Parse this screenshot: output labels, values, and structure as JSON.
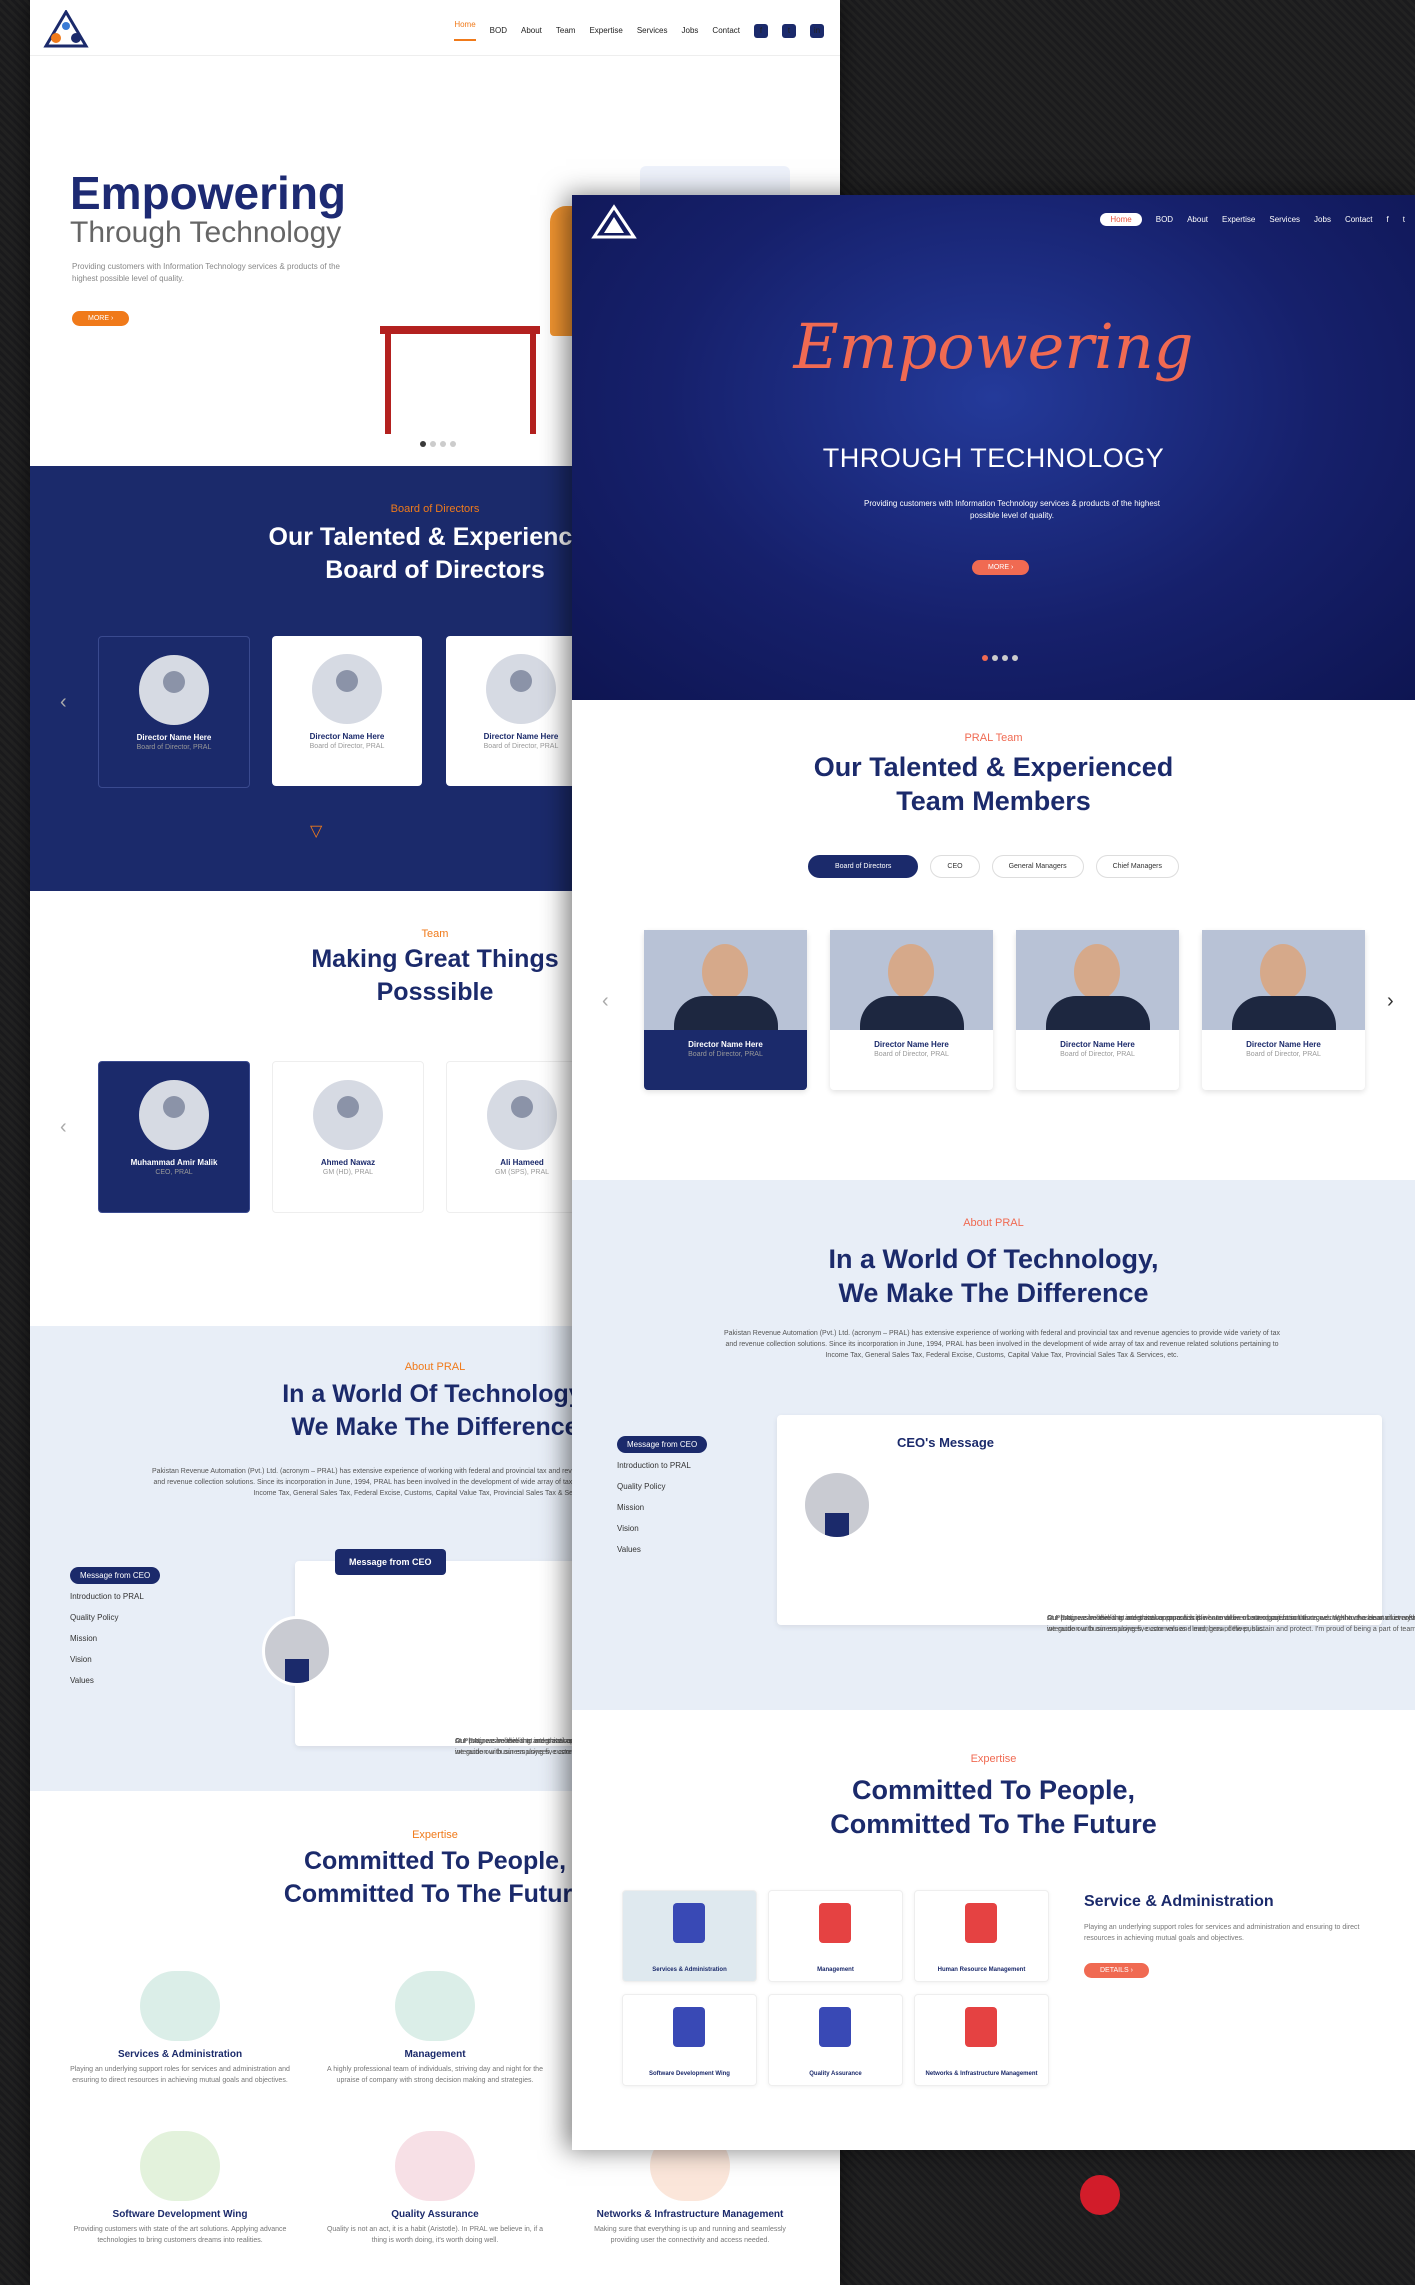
{
  "colors": {
    "navy": "#1b2a6b",
    "orange": "#f07a1a",
    "coral": "#f06a52",
    "light_blue": "#e8eef7"
  },
  "page_a": {
    "nav": [
      "Home",
      "BOD",
      "About",
      "Team",
      "Expertise",
      "Services",
      "Jobs",
      "Contact"
    ],
    "hero": {
      "title": "Empowering",
      "subtitle": "Through Technology",
      "text": "Providing customers with Information Technology services & products of the highest possible level of quality.",
      "button": "MORE ›"
    },
    "bod": {
      "label": "Board of Directors",
      "heading1": "Our Talented & Experienced",
      "heading2": "Board of Directors",
      "cards": [
        {
          "name": "Director Name Here",
          "role": "Board of Director, PRAL"
        },
        {
          "name": "Director Name Here",
          "role": "Board of Director, PRAL"
        },
        {
          "name": "Director Name Here",
          "role": "Board of Director, PRAL"
        }
      ]
    },
    "team": {
      "label": "Team",
      "heading1": "Making Great Things",
      "heading2": "Posssible",
      "cards": [
        {
          "name": "Muhammad Amir Malik",
          "role": "CEO, PRAL"
        },
        {
          "name": "Ahmed Nawaz",
          "role": "GM (HD), PRAL"
        },
        {
          "name": "Ali Hameed",
          "role": "GM (SPS), PRAL"
        }
      ]
    },
    "about": {
      "label": "About PRAL",
      "heading1": "In a World Of Technology,",
      "heading2": "We Make The Difference",
      "text": "Pakistan Revenue Automation (Pvt.) Ltd. (acronym – PRAL) has extensive experience of working with federal and provincial tax and revenue agencies to provide wide variety of tax and revenue collection solutions. Since its incorporation in June, 1994, PRAL has been involved in the development of wide array of tax and revenue related solutions pertaining to Income Tax, General Sales Tax, Federal Excise, Customs, Capital Value Tax, Provincial Sales Tax & Services, etc.",
      "menu": [
        "Message from CEO",
        "Introduction to PRAL",
        "Quality Policy",
        "Mission",
        "Vision",
        "Values"
      ],
      "ceo_tab": "Message from CEO",
      "ceo_text1": "At PRAL, we believe that an ethical approach is the core value of our organization that goes right to the heart of everything we stand for. Ethical values are evident in every interaction with our employees, customers and members of the public.",
      "ceo_text2": "Our business model is to integrate our core disciplines to deliver better project solutions across the chosen market areas.",
      "ceo_text3": "Our progressive thinking and creative approach is what makes us stand out from the crowd. We have a clear vision of what we want to be - leaders in the chosen market areas, and we guide our business using five core values - lead, grow, deliver, sustain and protect. I'm proud of being a part of team and the work we do in PRAL."
    },
    "expertise": {
      "label": "Expertise",
      "heading1": "Committed To People,",
      "heading2": "Committed To The Future",
      "services": [
        {
          "title": "Services & Administration",
          "desc": "Playing an underlying support roles for services and administration and ensuring to direct resources in achieving mutual goals and objectives."
        },
        {
          "title": "Management",
          "desc": "A highly professional team of individuals, striving day and night for the upraise of company with strong decision making and strategies."
        },
        {
          "title": "Software Development Wing",
          "desc": "Providing customers with state of the art solutions. Applying advance technologies to bring customers dreams into realities."
        },
        {
          "title": "Quality Assurance",
          "desc": "Quality is not an act, it is a habit (Aristotle). In PRAL we believe in, if a thing is worth doing, it's worth doing well."
        },
        {
          "title": "Networks & Infrastructure Management",
          "desc": "Making sure that everything is up and running and seamlessly providing user the connectivity and access needed."
        }
      ]
    }
  },
  "page_b": {
    "nav": [
      "Home",
      "BOD",
      "About",
      "Expertise",
      "Services",
      "Jobs",
      "Contact"
    ],
    "hero": {
      "script": "Empowering",
      "title": "THROUGH TECHNOLOGY",
      "text": "Providing customers with Information Technology services & products of the highest possible level of quality.",
      "button": "MORE ›"
    },
    "team": {
      "label": "PRAL Team",
      "heading1": "Our Talented & Experienced",
      "heading2": "Team Members",
      "tabs": [
        "Board of Directors",
        "CEO",
        "General Managers",
        "Chief Managers"
      ],
      "cards": [
        {
          "name": "Director Name Here",
          "role": "Board of Director, PRAL"
        },
        {
          "name": "Director Name Here",
          "role": "Board of Director, PRAL"
        },
        {
          "name": "Director Name Here",
          "role": "Board of Director, PRAL"
        },
        {
          "name": "Director Name Here",
          "role": "Board of Director, PRAL"
        }
      ]
    },
    "about": {
      "label": "About PRAL",
      "heading1": "In a World Of Technology,",
      "heading2": "We Make The Difference",
      "text": "Pakistan Revenue Automation (Pvt.) Ltd. (acronym – PRAL) has extensive experience of working with federal and provincial tax and revenue agencies to provide wide variety of tax and revenue collection solutions. Since its incorporation in June, 1994, PRAL has been involved in the development of wide array of tax and revenue related solutions pertaining to Income Tax, General Sales Tax, Federal Excise, Customs, Capital Value Tax, Provincial Sales Tax & Services, etc.",
      "menu": [
        "Message from CEO",
        "Introduction to PRAL",
        "Quality Policy",
        "Mission",
        "Vision",
        "Values"
      ],
      "ceo_title": "CEO's Message",
      "ceo_text1": "At PRAL, we believe that an ethical approach is the core value of our organization that goes right to the heart of everything we stand for. Ethical values are evident in every interaction with our employees, customers and members of the public.",
      "ceo_text2": "Our business model is to integrate our core disciplines to deliver better project solutions across the chosen market areas.",
      "ceo_text3": "Our progressive thinking and creative approach is what makes us stand out from the crowd. We have a clear vision of what we want to be - leaders in the chosen market areas, and we guide our business using five core values - lead, grow, deliver, sustain and protect. I'm proud of being a part of team and the work we do in PRAL."
    },
    "expertise": {
      "label": "Expertise",
      "heading1": "Committed To People,",
      "heading2": "Committed To The Future",
      "tiles": [
        "Services & Administration",
        "Management",
        "Human Resource Management",
        "Software Development Wing",
        "Quality Assurance",
        "Networks & Infrastructure Management"
      ],
      "selected_title": "Service & Administration",
      "selected_desc": "Playing an underlying support roles for services and administration and ensuring to direct resources in achieving mutual goals and objectives.",
      "button": "DETAILS ›"
    }
  }
}
